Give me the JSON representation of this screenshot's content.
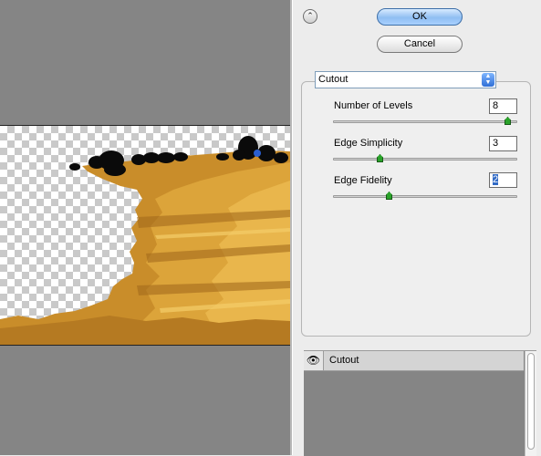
{
  "buttons": {
    "ok": "OK",
    "cancel": "Cancel",
    "collapse_icon": "double-chevron-up"
  },
  "filter": {
    "selected": "Cutout"
  },
  "parameters": [
    {
      "label": "Number of Levels",
      "value": "8",
      "level_pct": 100
    },
    {
      "label": "Edge Simplicity",
      "value": "3",
      "level_pct": 30
    },
    {
      "label": "Edge Fidelity",
      "value": "2",
      "level_pct": 35
    }
  ],
  "layers": [
    {
      "name": "Cutout",
      "visible": true
    }
  ],
  "colors": {
    "ok_blue": "#8fbef2",
    "slider_green": "#2aa22a",
    "preview_gray": "#858585"
  }
}
